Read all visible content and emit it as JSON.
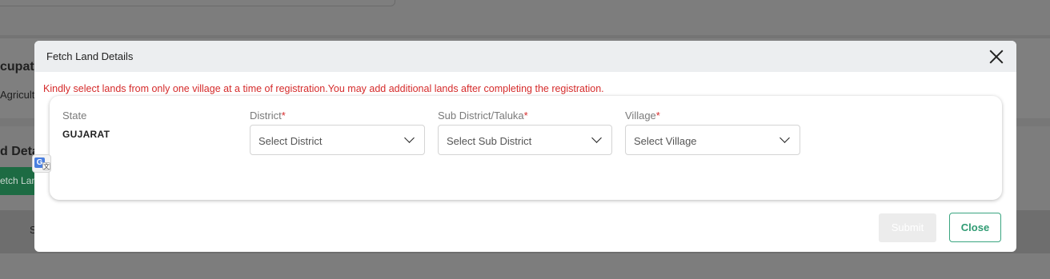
{
  "background": {
    "occupation_title": "cupatio",
    "occupation_value": "Agricult",
    "land_details_title": "d Deta",
    "fetch_button_label": "etch Lan",
    "table_col_initial": "S"
  },
  "modal": {
    "title": "Fetch Land Details",
    "warning": "Kindly select lands from only one village at a time of registration.You may add additional lands after completing the registration.",
    "state": {
      "label": "State",
      "value": "GUJARAT"
    },
    "district": {
      "label": "District",
      "required_mark": "*",
      "placeholder": "Select District"
    },
    "sub_district": {
      "label": "Sub District/Taluka",
      "required_mark": "*",
      "placeholder": "Select Sub District"
    },
    "village": {
      "label": "Village",
      "required_mark": "*",
      "placeholder": "Select Village"
    },
    "submit_label": "Submit",
    "close_label": "Close"
  },
  "icons": [
    "close-icon",
    "chevron-down-icon",
    "translate-icon"
  ]
}
